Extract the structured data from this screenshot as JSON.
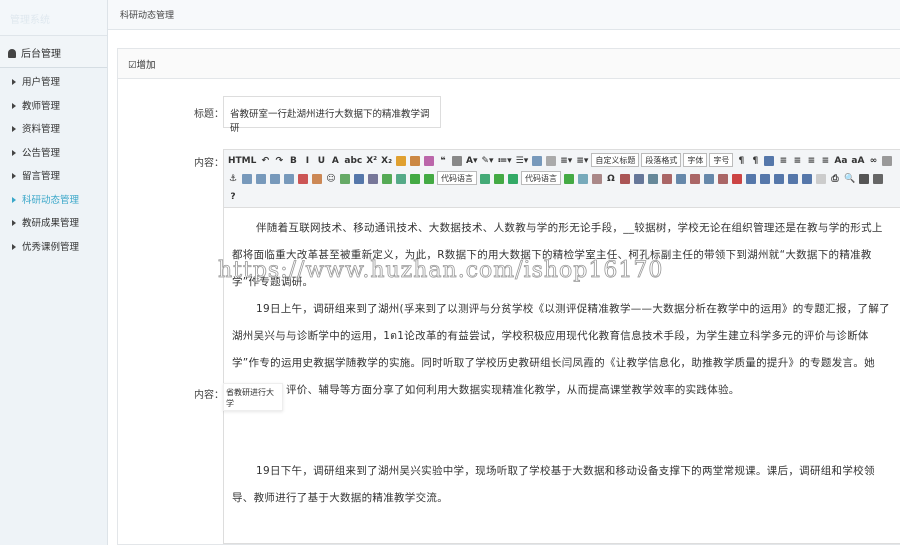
{
  "app": {
    "logo_text": "管理系统"
  },
  "sidebar": {
    "section": "后台管理",
    "items": [
      {
        "label": "用户管理"
      },
      {
        "label": "教师管理"
      },
      {
        "label": "资料管理"
      },
      {
        "label": "公告管理"
      },
      {
        "label": "留言管理"
      },
      {
        "label": "科研动态管理",
        "active": true
      },
      {
        "label": "教研成果管理"
      },
      {
        "label": "优秀课例管理"
      }
    ]
  },
  "breadcrumb": "科研动态管理",
  "panel": {
    "title": "增加"
  },
  "form": {
    "title_label": "标题：",
    "title_value": "省教研室一行赴湖州进行大数据下的精准教学调研",
    "content_label": "内容：",
    "content_label2": "内容：",
    "popup_text": "省教研进行大学"
  },
  "toolbar": {
    "items": [
      {
        "icon": "source-icon",
        "text": "HTML"
      },
      {
        "icon": "undo-icon",
        "text": "↶"
      },
      {
        "icon": "redo-icon",
        "text": "↷"
      },
      {
        "icon": "bold-icon",
        "text": "B"
      },
      {
        "icon": "italic-icon",
        "text": "I"
      },
      {
        "icon": "underline-icon",
        "text": "U"
      },
      {
        "icon": "font-border-icon",
        "text": "A"
      },
      {
        "icon": "strikethrough-icon",
        "text": "abc"
      },
      {
        "icon": "superscript-icon",
        "text": "X²"
      },
      {
        "icon": "subscript-icon",
        "text": "X₂"
      },
      {
        "icon": "format-match-icon",
        "color": "#e0a030"
      },
      {
        "icon": "clear-format-icon",
        "color": "#c84"
      },
      {
        "icon": "autotypeset-icon",
        "color": "#b6a"
      },
      {
        "icon": "blockquote-icon",
        "text": "❝"
      },
      {
        "icon": "paste-plain-icon",
        "color": "#888"
      },
      {
        "icon": "forecolor-icon",
        "text": "A▾"
      },
      {
        "icon": "backcolor-icon",
        "text": "✎▾"
      },
      {
        "icon": "ordered-list-icon",
        "text": "≔▾"
      },
      {
        "icon": "unordered-list-icon",
        "text": "☰▾"
      },
      {
        "icon": "select-all-icon",
        "color": "#79b"
      },
      {
        "icon": "cleardoc-icon",
        "color": "#aaa"
      },
      {
        "icon": "rowspacing-top-icon",
        "text": "≡▾"
      },
      {
        "icon": "rowspacing-bottom-icon",
        "text": "≡▾"
      },
      {
        "icon": "customstyle-select",
        "text": "自定义标题",
        "select": true
      },
      {
        "icon": "paragraph-select",
        "text": "段落格式",
        "select": true
      },
      {
        "icon": "fontfamily-select",
        "text": "字体",
        "select": true
      },
      {
        "icon": "fontsize-select",
        "text": "字号",
        "select": true
      },
      {
        "icon": "ltr-icon",
        "text": "¶"
      },
      {
        "icon": "rtl-icon",
        "text": "¶"
      },
      {
        "icon": "indent-icon",
        "color": "#57a"
      },
      {
        "icon": "justify-left-icon",
        "text": "≡"
      },
      {
        "icon": "justify-center-icon",
        "text": "≡"
      },
      {
        "icon": "justify-right-icon",
        "text": "≡"
      },
      {
        "icon": "justify-full-icon",
        "text": "≡"
      },
      {
        "icon": "touppercase-icon",
        "text": "Aa"
      },
      {
        "icon": "tolowercase-icon",
        "text": "aA"
      },
      {
        "icon": "link-icon",
        "text": "∞"
      },
      {
        "icon": "unlink-icon",
        "color": "#999"
      },
      {
        "icon": "anchor-icon",
        "text": "⚓"
      },
      {
        "icon": "image-float-none-icon",
        "color": "#79b"
      },
      {
        "icon": "image-left-icon",
        "color": "#79b"
      },
      {
        "icon": "image-right-icon",
        "color": "#79b"
      },
      {
        "icon": "image-center-icon",
        "color": "#79b"
      },
      {
        "icon": "insert-image-icon",
        "color": "#c55"
      },
      {
        "icon": "multi-image-icon",
        "color": "#c85"
      },
      {
        "icon": "emotion-icon",
        "text": "☺"
      },
      {
        "icon": "scrawl-icon",
        "color": "#6a6"
      },
      {
        "icon": "video-icon",
        "color": "#57a"
      },
      {
        "icon": "attachment-icon",
        "color": "#779"
      },
      {
        "icon": "map-icon",
        "color": "#5a5"
      },
      {
        "icon": "gmap-icon",
        "color": "#5a8"
      },
      {
        "icon": "frame-icon",
        "color": "#4a4"
      },
      {
        "icon": "code-icon",
        "color": "#4a4"
      },
      {
        "icon": "code-language-select",
        "text": "代码语言",
        "select": true
      },
      {
        "icon": "pagebreak-icon",
        "color": "#4a7"
      },
      {
        "icon": "template-icon",
        "color": "#4a4"
      },
      {
        "icon": "background-icon",
        "color": "#3a6"
      },
      {
        "icon": "code-language-select-2",
        "text": "代码语言",
        "select": true
      },
      {
        "icon": "horizontal-icon",
        "color": "#4a4"
      },
      {
        "icon": "date-icon",
        "color": "#7ab"
      },
      {
        "icon": "time-icon",
        "color": "#a88"
      },
      {
        "icon": "spechars-icon",
        "text": "Ω"
      },
      {
        "icon": "wordimage-icon",
        "color": "#a55"
      },
      {
        "icon": "snapscreen-icon",
        "color": "#679"
      },
      {
        "icon": "inserttable-icon",
        "color": "#689"
      },
      {
        "icon": "deletetable-icon",
        "color": "#a66"
      },
      {
        "icon": "insert-row-icon",
        "color": "#68a"
      },
      {
        "icon": "delete-row-icon",
        "color": "#a66"
      },
      {
        "icon": "insert-col-icon",
        "color": "#68a"
      },
      {
        "icon": "delete-col-icon",
        "color": "#a66"
      },
      {
        "icon": "merge-cells-icon",
        "color": "#c44"
      },
      {
        "icon": "merge-right-icon",
        "color": "#57a"
      },
      {
        "icon": "merge-down-icon",
        "color": "#57a"
      },
      {
        "icon": "split-cells-icon",
        "color": "#57a"
      },
      {
        "icon": "split-rows-icon",
        "color": "#57a"
      },
      {
        "icon": "split-cols-icon",
        "color": "#57a"
      },
      {
        "icon": "chart-icon",
        "color": "#ccc"
      },
      {
        "icon": "print-icon",
        "text": "⎙"
      },
      {
        "icon": "preview-icon",
        "text": "🔍"
      },
      {
        "icon": "search-replace-icon",
        "color": "#555"
      },
      {
        "icon": "drafts-icon",
        "color": "#666"
      },
      {
        "icon": "help-icon",
        "text": "?"
      }
    ]
  },
  "content": {
    "lines": [
      "伴随着互联网技术、移动通讯技术、大数据技术、人数教与学的形无论手段，__较据树，学校无论在组织管理还是在教与学的形式上",
      "都将面临重大改革甚至被重新定义，为此，R数据下的用大数据下的精检学室主任、柯孔标副主任的带领下到湖州就“大数据下的精准教",
      "学”作专题调研。",
      "19日上午，调研组来到了湖州(孚来到了以测评与分贫学校《以测评促精准教学——大数据分析在教学中的运用》的专题汇报，了解了",
      "湖州吴兴与与诊断学中的运用，1ต1论改革的有益尝试，学校积极应用现代化教育信息技术手段，为学生建立科学多元的评价与诊断体",
      "学”作专的运用史教据学随教学的实施。同时听取了学校历史教研组长闫凤霞的《让教学信息化，助推教学质量的提升》的专题发言。她",
      "进行大学、评价、辅导等方面分享了如何利用大数据实现精准化教学，从而提高课堂教学效率的实践体验。",
      "",
      "",
      "19日下午，调研组来到了湖州吴兴实验中学，现场听取了学校基于大数据和移动设备支撑下的两堂常规课。课后，调研组和学校领",
      "导、教师进行了基于大数据的精准教学交流。"
    ],
    "indent": [
      true,
      false,
      false,
      true,
      false,
      false,
      false,
      false,
      false,
      true,
      false
    ]
  },
  "watermark": "https://www.huzhan.com/ishop16170"
}
